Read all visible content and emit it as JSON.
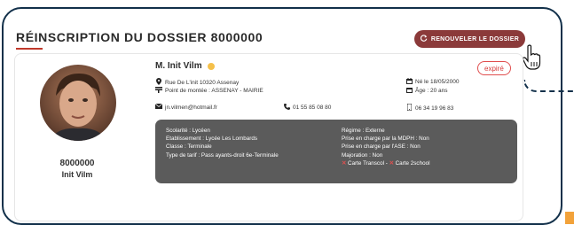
{
  "header": {
    "title": "RÉINSCRIPTION DU DOSSIER 8000000",
    "renew_label": "RENOUVELER LE DOSSIER"
  },
  "student": {
    "id": "8000000",
    "name_short": "Init Vilm",
    "full_name": "M. Init Vilm",
    "status_badge": "expiré",
    "address": "Rue De L'init 10320 Assenay",
    "pickup_point": "Point de montée : ASSENAY - MAIRIE",
    "email": "jn.vilmen@hotmail.fr",
    "phone": "01 55 85 08 80",
    "birth": "Né le 18/05/2000",
    "age": "Âge : 20 ans",
    "mobile": "06 34 19 96 83"
  },
  "details": {
    "left": [
      "Scolarité : Lycéen",
      "Etablissement : Lycée Les Lombards",
      "Classe : Terminale",
      "Type de tarif : Pass ayants-droit 6e-Terminale"
    ],
    "right": [
      "Régime : Externe",
      "Prise en charge par la MDPH : Non",
      "Prise en charge par l'ASE : Non",
      "Majoration : Non"
    ],
    "cards": [
      "Carte Transcol",
      "Carte 2school"
    ]
  },
  "icons": {
    "address": "map-pin-icon",
    "pickup": "bus-stop-icon",
    "email": "envelope-icon",
    "phone": "phone-icon",
    "birth": "calendar-icon",
    "age": "calendar-icon",
    "mobile": "mobile-icon",
    "renew": "refresh-icon",
    "cursor": "hand-pointer-icon"
  },
  "colors": {
    "accent": "#c0392b",
    "button_bg": "#8b3a3a",
    "badge": "#d63b3b",
    "status_dot": "#f5c04a",
    "details_bg": "#5b5b5b",
    "frame": "#12304a"
  }
}
